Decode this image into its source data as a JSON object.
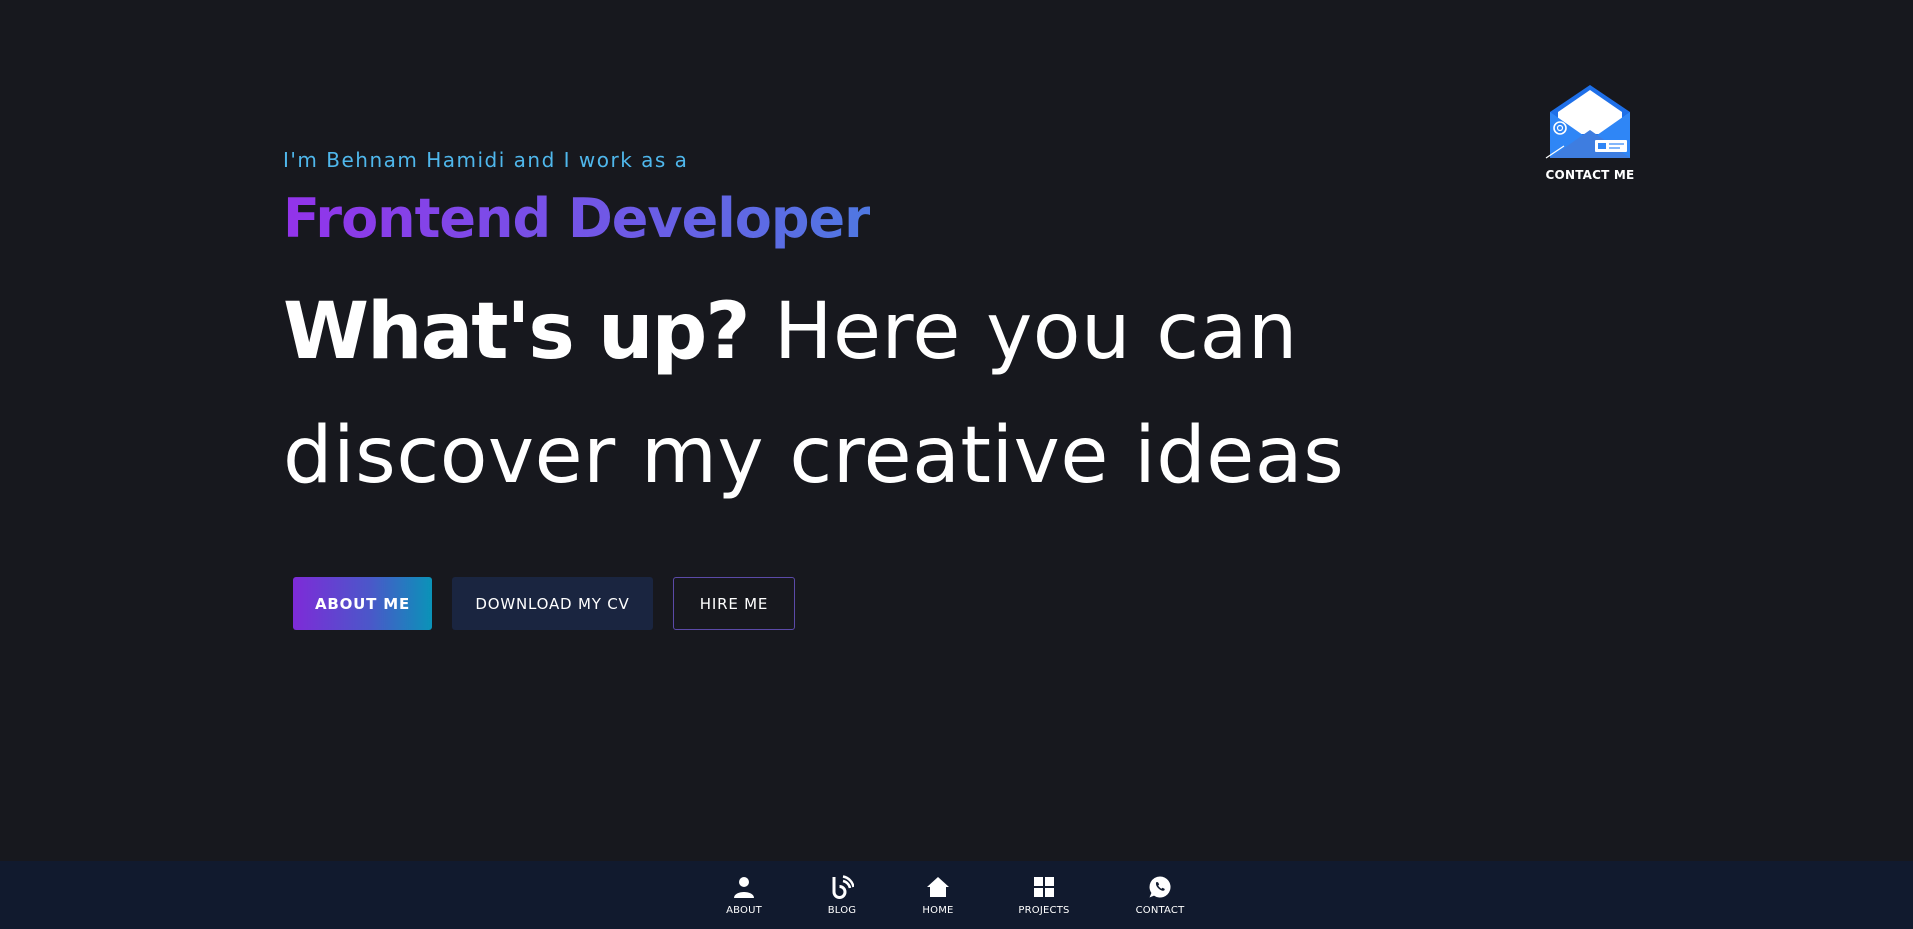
{
  "hero": {
    "intro": "I'm Behnam Hamidi and I work as a",
    "role": "Frontend Developer",
    "headline_strong": "What's up?",
    "headline_rest_line1": " Here you can",
    "headline_line2": "discover my creative ideas"
  },
  "actions": {
    "about_label": "ABOUT ME",
    "cv_label": "DOWNLOAD MY CV",
    "hire_label": "HIRE ME"
  },
  "contact_badge": {
    "label": "CONTACT ME",
    "icon": "envelope-icon"
  },
  "bottom_nav": {
    "items": [
      {
        "label": "ABOUT",
        "icon": "user-icon"
      },
      {
        "label": "BLOG",
        "icon": "blog-icon"
      },
      {
        "label": "HOME",
        "icon": "home-icon"
      },
      {
        "label": "PROJECTS",
        "icon": "grid-icon"
      },
      {
        "label": "CONTACT",
        "icon": "whatsapp-icon"
      }
    ]
  },
  "colors": {
    "background": "#17181e",
    "nav_background": "#111a2e",
    "intro_text": "#4fb7ec",
    "accent_purple": "#9333ea",
    "accent_blue": "#4f78e2"
  }
}
